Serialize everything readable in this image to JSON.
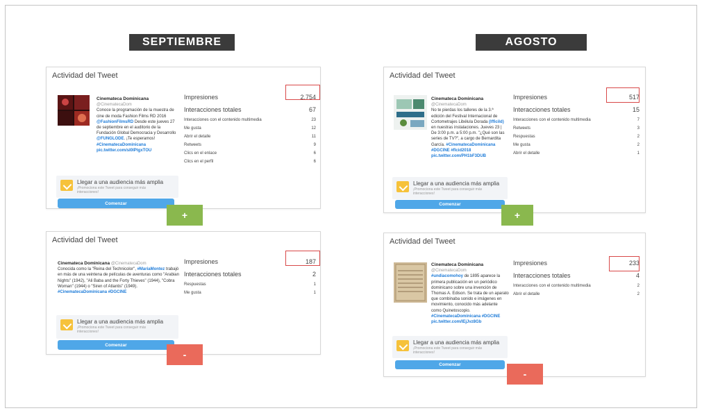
{
  "headers": {
    "left": "SEPTIEMBRE",
    "right": "AGOSTO"
  },
  "card_title": "Actividad del Tweet",
  "cards": {
    "sep_top": {
      "author": "Cinemateca Dominicana",
      "handle": "@CinematecaDom",
      "text": "Conoce la programación de la muestra de cine de moda Fashion Films RD 2016",
      "hashtag1": "@FashionFilmsRD",
      "text2": "Desde este jueves 27 de septiembre en el auditorio de la Fundación Global Democracia y Desarrollo",
      "mention": "@FUNGLODE",
      "text3": ". ¡Te esperamos!",
      "hashtag2": "#CinematecaDominicana",
      "link": "pic.twitter.com/sI0IPtgxTOU",
      "stats": [
        {
          "label": "Impresiones",
          "value": "2.754"
        },
        {
          "label": "Interacciones totales",
          "value": "67"
        },
        {
          "label": "Interacciones con el contenido multimedia",
          "value": "23"
        },
        {
          "label": "Me gusta",
          "value": "12"
        },
        {
          "label": "Abrir el detalle",
          "value": "11"
        },
        {
          "label": "Retweets",
          "value": "9"
        },
        {
          "label": "Clics en el enlace",
          "value": "6"
        },
        {
          "label": "Clics en el perfil",
          "value": "6"
        }
      ]
    },
    "sep_bottom": {
      "author": "Cinemateca Dominicana",
      "handle": "@CinematecaDom",
      "text_prefix": "Conocida como la \"Reina del Technicolor\",",
      "hashtag1": "#MariaMontez",
      "text": "trabajó en más de una veintena de películas de aventuras como \"Arabian Nights\" (1942), \"Ali Baba and the Forty Thieves\" (1944), \"Cobra Woman\" (1944) o \"Siren of Atlantis\" (1949).",
      "hashtag2": "#CinematecaDominicana #DGCINE",
      "stats": [
        {
          "label": "Impresiones",
          "value": "187"
        },
        {
          "label": "Interacciones totales",
          "value": "2"
        },
        {
          "label": "Respuestas",
          "value": "1"
        },
        {
          "label": "Me gusta",
          "value": "1"
        }
      ]
    },
    "ago_top": {
      "author": "Cinemateca Dominicana",
      "handle": "@CinematecaDom",
      "text": "No te pierdas los talleres de la 3.ª edición del Festival Internacional de Cortometrajes Libélula Dorada",
      "mention": "(lfficild)",
      "text2": "en nuestras instalaciones. Jueves 23 | De 3:00 p.m. a 5:00 p.m. \"¿Qué son las series de TV?\", a cargo de Bernardita García.",
      "hashtag2": "#CinematecaDominicana #DGCINE #flcid2018",
      "link": "pic.twitter.com/PH1bF3DUB",
      "stats": [
        {
          "label": "Impresiones",
          "value": "517"
        },
        {
          "label": "Interacciones totales",
          "value": "15"
        },
        {
          "label": "Interacciones con el contenido multimedia",
          "value": "7"
        },
        {
          "label": "Retweets",
          "value": "3"
        },
        {
          "label": "Respuestas",
          "value": "2"
        },
        {
          "label": "Me gusta",
          "value": "2"
        },
        {
          "label": "Abrir el detalle",
          "value": "1"
        }
      ]
    },
    "ago_bottom": {
      "author": "Cinemateca Dominicana",
      "handle": "@CinematecaDom",
      "hashtag1": "#undiacomohoy",
      "text": "de 1895 aparece la primera publicación en un periódico dominicano sobre una invención de Thomas A. Edison. Se trata de un aparato que combinaba sonido e imágenes en movimiento, conocido más adelante como Quinetoscopio.",
      "hashtag2": "#CinematecaDominicana #DGCINE",
      "link": "pic.twitter.com/IEjJvz8Gb",
      "stats": [
        {
          "label": "Impresiones",
          "value": "233"
        },
        {
          "label": "Interacciones totales",
          "value": "4"
        },
        {
          "label": "Interacciones con el contenido multimedia",
          "value": "2"
        },
        {
          "label": "Abrir el detalle",
          "value": "2"
        }
      ]
    }
  },
  "promo": {
    "title": "Llegar a una audiencia más amplia",
    "subtitle": "¡Promociona este Tweet para conseguir más interacciones!",
    "button": "Comenzar"
  },
  "buttons": {
    "plus": "+",
    "minus": "-"
  },
  "colors": {
    "header_bg": "#3b3b3b",
    "plus": "#8ab84e",
    "minus": "#ea6a5b",
    "highlight": "#d84848",
    "link": "#1d7bd8"
  }
}
